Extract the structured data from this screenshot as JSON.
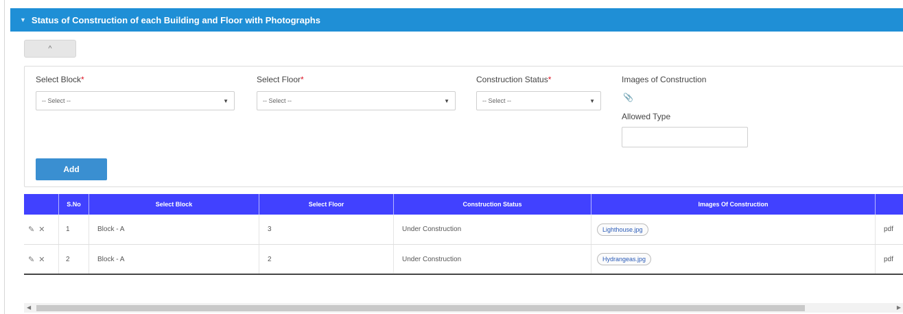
{
  "panel": {
    "title": "Status of Construction of each Building and Floor with Photographs",
    "title_icon": "chevron-down-icon",
    "collapse_label": "^"
  },
  "form": {
    "block": {
      "label": "Select Block",
      "required": "*",
      "value": "-- Select --"
    },
    "floor": {
      "label": "Select Floor",
      "required": "*",
      "value": "-- Select --"
    },
    "status": {
      "label": "Construction Status",
      "required": "*",
      "value": "-- Select --"
    },
    "images": {
      "label": "Images of Construction",
      "icon": "paperclip-icon"
    },
    "allowed_type": {
      "label": "Allowed Type",
      "value": ""
    },
    "add_label": "Add"
  },
  "table": {
    "headers": [
      "S.No",
      "Select Block",
      "Select Floor",
      "Construction Status",
      "Images Of Construction",
      ""
    ],
    "rows": [
      {
        "sno": "1",
        "block": "Block - A",
        "floor": "3",
        "status": "Under Construction",
        "image": "Lighthouse.jpg",
        "type": "pdf"
      },
      {
        "sno": "2",
        "block": "Block - A",
        "floor": "2",
        "status": "Under Construction",
        "image": "Hydrangeas.jpg",
        "type": "pdf"
      }
    ],
    "row_icons": [
      "edit-icon",
      "delete-icon"
    ]
  },
  "colors": {
    "header": "#1f8fd6",
    "table_header": "#4141ff",
    "add_button": "#3a8fd1"
  }
}
